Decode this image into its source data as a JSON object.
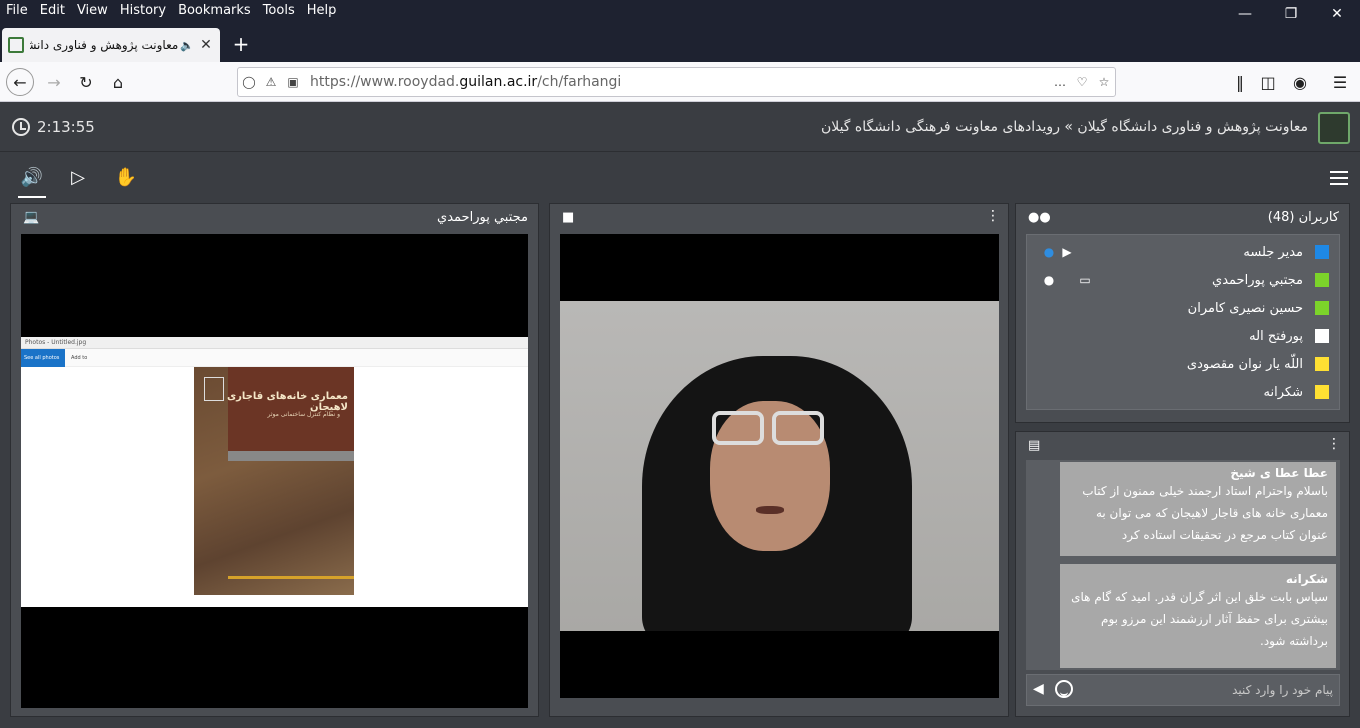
{
  "browser": {
    "menus": [
      "File",
      "Edit",
      "View",
      "History",
      "Bookmarks",
      "Tools",
      "Help"
    ],
    "tab_title": "معاونت پژوهش و فناوری دانشگاه",
    "url_prefix": "https://www.rooydad.",
    "url_domain": "guilan.ac.ir",
    "url_path": "/ch/farhangi"
  },
  "app": {
    "timer": "2:13:55",
    "breadcrumb": "معاونت پژوهش و فناوری دانشگاه گیلان » رویدادهای معاونت فرهنگی دانشگاه گیلان"
  },
  "screenshare": {
    "presenter": "مجتبي پوراحمدي",
    "window_title": "Photos - Untitled.jpg",
    "see_all_label": "See all photos",
    "add_label": "Add to",
    "book_title": "معماری خانه‌های قاجاری لاهیجان",
    "book_subtitle": "و نظام کنترل ساختمانی موثر"
  },
  "users": {
    "title": "کاربران (48)",
    "list": [
      {
        "name": "مدير جلسه",
        "color": "#1e88e5",
        "mic": true,
        "cam": true,
        "screen": false
      },
      {
        "name": "مجتبي پوراحمدي",
        "color": "#7cd32a",
        "mic": true,
        "cam": false,
        "screen": true
      },
      {
        "name": "حسين نصيرى كامران",
        "color": "#7cd32a",
        "mic": false,
        "cam": false,
        "screen": false
      },
      {
        "name": "پورفتح اله",
        "color": "#ffffff",
        "mic": false,
        "cam": false,
        "screen": false
      },
      {
        "name": "اللّه يار نوان مقصودی",
        "color": "#ffe033",
        "mic": false,
        "cam": false,
        "screen": false
      },
      {
        "name": "شکرانه",
        "color": "#ffe033",
        "mic": false,
        "cam": false,
        "screen": false
      }
    ]
  },
  "chat": {
    "messages": [
      {
        "sender": "عطا عطا ی شیخ",
        "text": "باسلام واحترام استاد ارجمند خیلی ممنون از کتاب معماری خانه های قاجار لاهیجان که می توان به عنوان کتاب مرجع  در تحقیقات استاده کرد"
      },
      {
        "sender": "شکرانه",
        "text": "سپاس بابت خلق این اثر گران قدر. امید که گام های بیشتری برای حفظ آثار ارزشمند این مرزو بوم برداشته شود."
      }
    ],
    "placeholder": "پیام خود را وارد کنید"
  }
}
